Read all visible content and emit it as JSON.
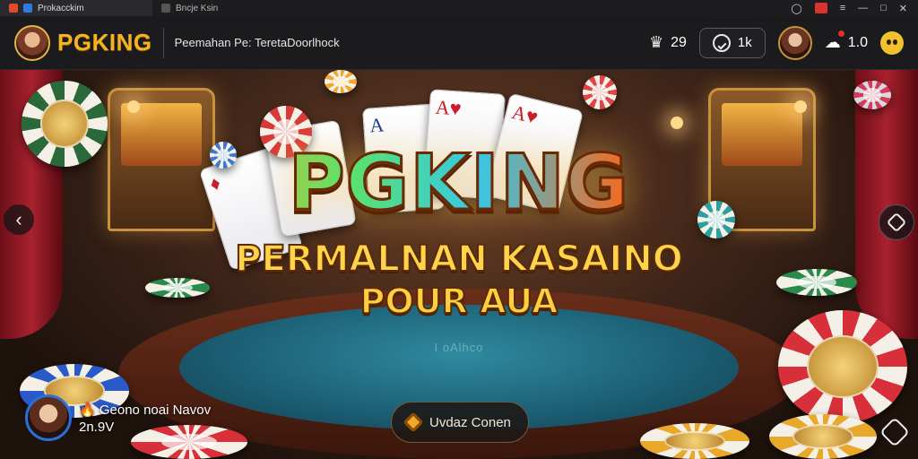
{
  "browser": {
    "tabs": [
      {
        "title": "Prokacckim",
        "active": true
      },
      {
        "title": "Bncje Ksin",
        "active": false
      }
    ],
    "window_controls": [
      "minimize",
      "maximize",
      "close"
    ]
  },
  "header": {
    "logo_text": "PGKING",
    "subtitle": "Peemahan Pe: TeretaDoorlhock",
    "stat_count": "29",
    "pill_value": "1k",
    "notif_value": "1.0",
    "icons": [
      "trophy-icon",
      "check-circle-icon",
      "avatar",
      "notification-icon",
      "emoji-face-icon"
    ]
  },
  "hero": {
    "title": "PGKING",
    "subtitle_line1": "PERMALNAN KASAINO",
    "subtitle_line2": "POUR AUA",
    "felt_text": "I oAlhco",
    "cta_label": "Uvdaz Conen",
    "profile": {
      "name_prefix": "🔥",
      "name": "Geono noai Navov",
      "amount": "2n.9V"
    },
    "colors": {
      "title_gold": "#ffd23a",
      "felt": "#1b5d72",
      "curtain": "#a8222e"
    }
  }
}
